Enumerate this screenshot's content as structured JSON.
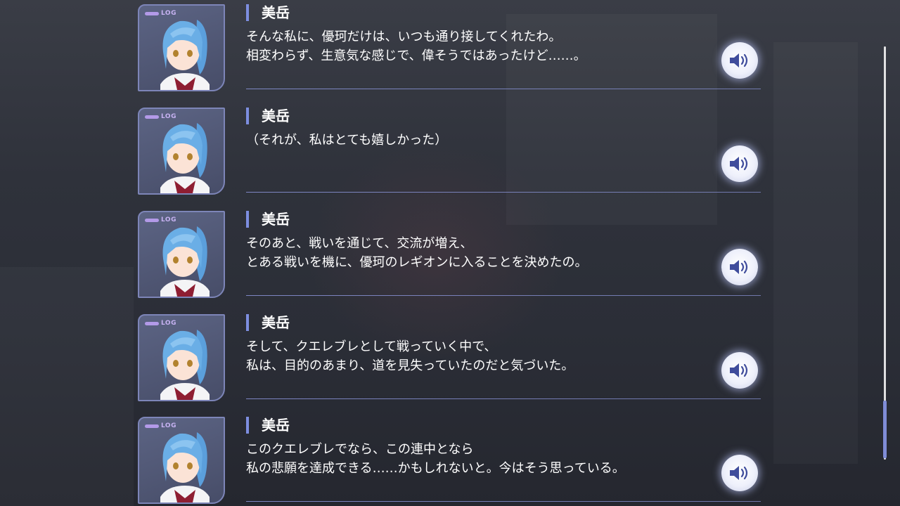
{
  "log_tag": "LOG",
  "entries": [
    {
      "speaker": "美岳",
      "lines": [
        "そんな私に、優珂だけは、いつも通り接してくれたわ。",
        "相変わらず、生意気な感じで、偉そうではあったけど……。"
      ],
      "voice_icon": "speaker-icon"
    },
    {
      "speaker": "美岳",
      "lines": [
        "（それが、私はとても嬉しかった）",
        ""
      ],
      "voice_icon": "speaker-icon"
    },
    {
      "speaker": "美岳",
      "lines": [
        "そのあと、戦いを通じて、交流が増え、",
        "とある戦いを機に、優珂のレギオンに入ることを決めたの。"
      ],
      "voice_icon": "speaker-icon"
    },
    {
      "speaker": "美岳",
      "lines": [
        "そして、クエレブレとして戦っていく中で、",
        "私は、目的のあまり、道を見失っていたのだと気づいた。"
      ],
      "voice_icon": "speaker-icon"
    },
    {
      "speaker": "美岳",
      "lines": [
        "このクエレブレでなら、この連中となら",
        "私の悲願を達成できる……かもしれないと。今はそう思っている。"
      ],
      "voice_icon": "speaker-icon"
    }
  ],
  "colors": {
    "accent": "#7d8ee0",
    "log_tag": "#b39ae8",
    "divider": "#8c96dc",
    "scroll_thumb": "#7f8cd6"
  }
}
